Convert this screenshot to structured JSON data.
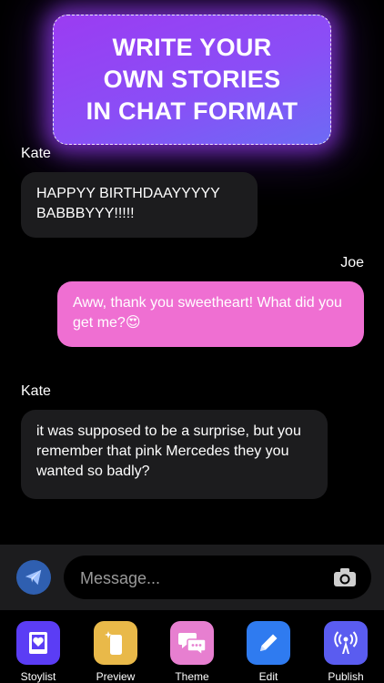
{
  "banner": {
    "text": "WRITE YOUR\nOWN STORIES\nIN CHAT FORMAT"
  },
  "messages": [
    {
      "sender": "Kate",
      "text": "HAPPYY BIRTHDAAYYYYY BABBBYYY!!!!!",
      "side": "left"
    },
    {
      "sender": "Joe",
      "text": "Aww, thank you sweetheart! What did you get me?😍",
      "side": "right"
    },
    {
      "sender": "Kate",
      "text": "it was supposed to be a surprise, but you remember that pink Mercedes they you wanted so badly?",
      "side": "left"
    }
  ],
  "composer": {
    "placeholder": "Message...",
    "send_icon": "paper-plane-icon",
    "camera_icon": "camera-icon"
  },
  "tabs": [
    {
      "label": "Stoylist",
      "icon": "book-heart-icon",
      "color": "#5b3df5"
    },
    {
      "label": "Preview",
      "icon": "phone-sparkle-icon",
      "color": "#e9b949"
    },
    {
      "label": "Theme",
      "icon": "chat-bubbles-icon",
      "color": "#e77fd0"
    },
    {
      "label": "Edit",
      "icon": "pencil-icon",
      "color": "#2f7bf0"
    },
    {
      "label": "Publish",
      "icon": "broadcast-icon",
      "color": "#5a5cf0"
    }
  ]
}
